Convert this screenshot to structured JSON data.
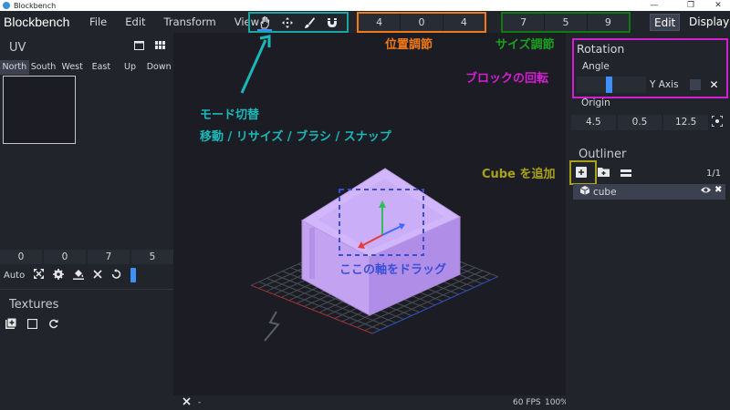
{
  "titlebar": {
    "title": "Blockbench",
    "minimize": "—",
    "restore": "❐",
    "close": "✕"
  },
  "menubar": {
    "brand": "Blockbench",
    "items": [
      "File",
      "Edit",
      "Transform",
      "View"
    ],
    "modes": {
      "edit": "Edit",
      "display": "Display"
    }
  },
  "toolbar": {
    "tools": [
      {
        "icon": "hand-move-icon",
        "active": true
      },
      {
        "icon": "move-arrows-icon",
        "active": false
      },
      {
        "icon": "brush-icon",
        "active": false
      },
      {
        "icon": "magnet-icon",
        "active": false
      }
    ],
    "position": [
      "4",
      "0",
      "4"
    ],
    "size": [
      "7",
      "5",
      "9"
    ]
  },
  "uv": {
    "title": "UV",
    "faces": [
      "North",
      "South",
      "West",
      "East",
      "Up",
      "Down"
    ],
    "active_face": "North",
    "values": [
      "0",
      "0",
      "7",
      "5"
    ],
    "auto_label": "Auto"
  },
  "textures": {
    "title": "Textures"
  },
  "rotation": {
    "title": "Rotation",
    "angle_label": "Angle",
    "angle_level": 0.47,
    "axis": "Y Axis",
    "origin_label": "Origin",
    "origin": [
      "4.5",
      "0.5",
      "12.5"
    ]
  },
  "outliner": {
    "title": "Outliner",
    "count": "1/1",
    "items": [
      {
        "name": "cube"
      }
    ]
  },
  "status": {
    "left_text": "-",
    "fps": "60 FPS",
    "zoom": "100%"
  },
  "annotations": {
    "mode_switch": "モード切替",
    "tools_desc": "移動 / リサイズ / ブラシ / スナップ",
    "position_adjust": "位置調節",
    "size_adjust": "サイズ調節",
    "block_rotation": "ブロックの回転",
    "add_cube": "Cube を追加",
    "drag_axis": "ここの軸をドラッグ"
  },
  "colors": {
    "teal": "#1aa5a5",
    "orange": "#f37a16",
    "green": "#0f7a11",
    "magenta": "#d31ed3",
    "olive": "#a9a218",
    "blue": "#3a4ed8",
    "accent": "#3e90ff",
    "cube": "#c9a8ff"
  }
}
